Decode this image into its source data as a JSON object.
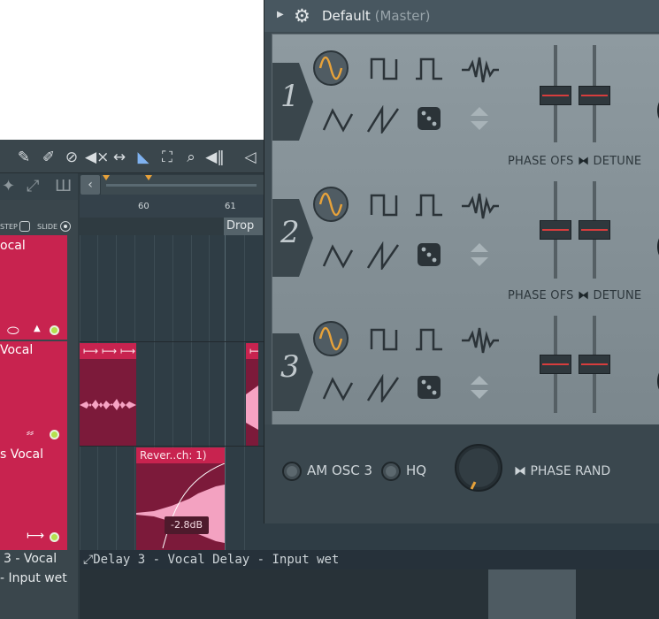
{
  "toolbar": {
    "icons": [
      "pencil-icon",
      "paint-icon",
      "delete-icon",
      "mute-icon",
      "slip-icon",
      "select-icon",
      "zoom-icon",
      "playback-icon",
      "speaker-icon"
    ]
  },
  "playlist": {
    "step_label": "STEP",
    "slide_label": "SLIDE",
    "ruler": {
      "bar_60": "60",
      "bar_61": "61"
    },
    "marker": "Drop",
    "tracks": [
      {
        "name": "ocal"
      },
      {
        "name": "Vocal"
      },
      {
        "name": "s Vocal"
      }
    ],
    "clips": {
      "reverse_clip_title": "Rever..ch: 1)",
      "gain": "-2.8dB"
    },
    "automation": {
      "left_line1": "3 - Vocal",
      "left_line2": "- Input wet",
      "lane_title": "Delay 3 - Vocal Delay - Input wet"
    }
  },
  "plugin": {
    "preset": "Default",
    "target": "(Master)",
    "oscillators": [
      {
        "number": "1",
        "selected_wave": "sine"
      },
      {
        "number": "2",
        "selected_wave": "sine"
      },
      {
        "number": "3",
        "selected_wave": "sine"
      }
    ],
    "fader_labels": {
      "phase": "PHASE OFS",
      "detune": "DETUNE"
    },
    "options": {
      "am_label": "AM OSC 3",
      "hq_label": "HQ",
      "phase_rand_label": "PHASE RAND"
    }
  },
  "colors": {
    "track_accent": "#c8234f",
    "sine_wave": "#e7a23a",
    "fader_line": "#d63d3d",
    "led_green": "#b4e04e"
  }
}
